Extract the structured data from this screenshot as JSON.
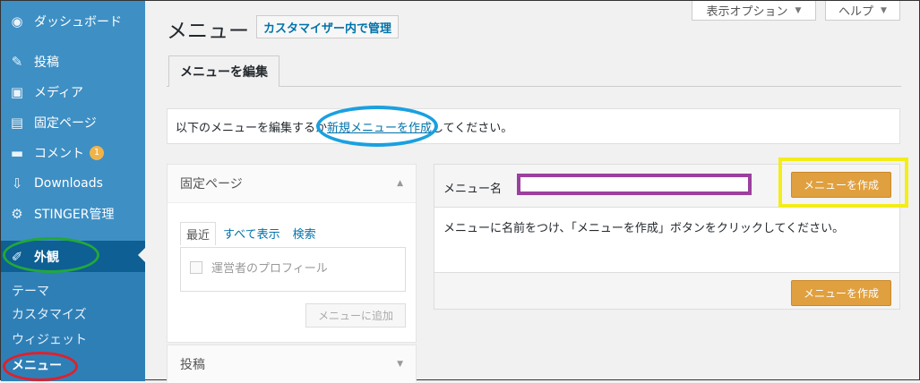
{
  "sidebar": {
    "items": [
      {
        "label": "ダッシュボード",
        "icon": "dashboard-icon"
      },
      {
        "label": "投稿",
        "icon": "pin-icon"
      },
      {
        "label": "メディア",
        "icon": "media-icon"
      },
      {
        "label": "固定ページ",
        "icon": "page-icon"
      },
      {
        "label": "コメント",
        "icon": "comment-icon",
        "badge": "1"
      },
      {
        "label": "Downloads",
        "icon": "download-icon"
      },
      {
        "label": "STINGER管理",
        "icon": "gear-icon"
      },
      {
        "label": "外観",
        "icon": "paintbrush-icon"
      }
    ],
    "submenu": [
      "テーマ",
      "カスタマイズ",
      "ウィジェット",
      "メニュー"
    ]
  },
  "header": {
    "screen_options": "表示オプション",
    "help": "ヘルプ",
    "title": "メニュー",
    "customizer_link": "カスタマイザー内で管理"
  },
  "tabs": {
    "edit": "メニューを編集"
  },
  "notice": {
    "before": "以下のメニューを編集するか",
    "link": "新規メニューを作成",
    "after": "してください。"
  },
  "left_panel": {
    "pages_title": "固定ページ",
    "tabs": [
      "最近",
      "すべて表示",
      "検索"
    ],
    "checkbox_label": "運営者のプロフィール",
    "add_button": "メニューに追加",
    "posts_title": "投稿"
  },
  "right_panel": {
    "name_label": "メニュー名",
    "name_value": "",
    "create_button": "メニューを作成",
    "instruction": "メニューに名前をつけ、「メニューを作成」ボタンをクリックしてください。"
  },
  "colors": {
    "sidebar_bg": "#3e8fc4",
    "accent": "#e0a03f",
    "highlight_blue": "#1aa0e0",
    "highlight_green": "#22a83a",
    "highlight_red": "#e0202a",
    "highlight_purple": "#9c3f9e",
    "highlight_yellow": "#f3ed18"
  }
}
